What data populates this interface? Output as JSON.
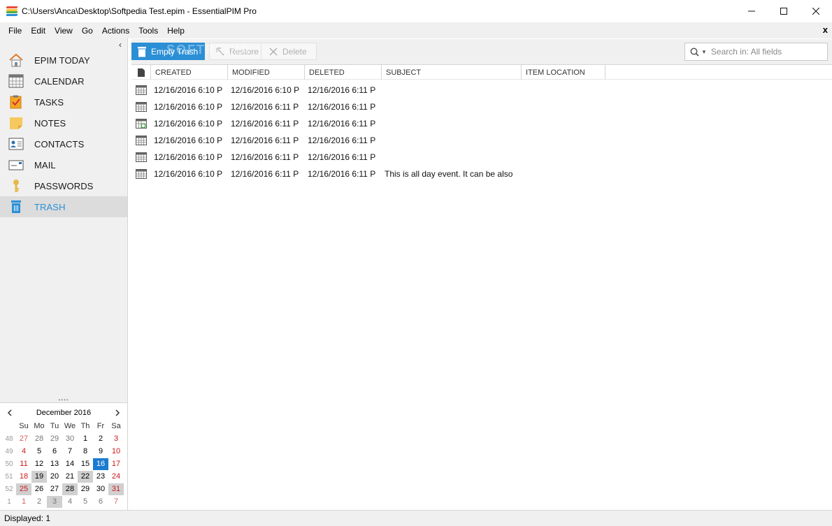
{
  "window": {
    "title": "C:\\Users\\Anca\\Desktop\\Softpedia Test.epim - EssentialPIM Pro",
    "minimize": "—",
    "maximize": "☐",
    "close": "✕"
  },
  "menu": {
    "items": [
      "File",
      "Edit",
      "View",
      "Go",
      "Actions",
      "Tools",
      "Help"
    ],
    "close": "x"
  },
  "sidebar": {
    "collapse": "‹",
    "items": [
      {
        "label": "EPIM TODAY",
        "icon": "house-icon"
      },
      {
        "label": "CALENDAR",
        "icon": "calendar-icon"
      },
      {
        "label": "TASKS",
        "icon": "clipboard-check-icon"
      },
      {
        "label": "NOTES",
        "icon": "sticky-note-icon"
      },
      {
        "label": "CONTACTS",
        "icon": "contact-card-icon"
      },
      {
        "label": "MAIL",
        "icon": "envelope-icon"
      },
      {
        "label": "PASSWORDS",
        "icon": "key-icon"
      },
      {
        "label": "TRASH",
        "icon": "trash-icon",
        "active": true
      }
    ]
  },
  "calendar": {
    "prev": "‹",
    "next": "›",
    "title": "December  2016",
    "days": [
      "Su",
      "Mo",
      "Tu",
      "We",
      "Th",
      "Fr",
      "Sa"
    ],
    "weeks": [
      {
        "wk": "48",
        "dates": [
          "27",
          "28",
          "29",
          "30",
          "1",
          "2",
          "3"
        ]
      },
      {
        "wk": "49",
        "dates": [
          "4",
          "5",
          "6",
          "7",
          "8",
          "9",
          "10"
        ]
      },
      {
        "wk": "50",
        "dates": [
          "11",
          "12",
          "13",
          "14",
          "15",
          "16",
          "17"
        ]
      },
      {
        "wk": "51",
        "dates": [
          "18",
          "19",
          "20",
          "21",
          "22",
          "23",
          "24"
        ]
      },
      {
        "wk": "52",
        "dates": [
          "25",
          "26",
          "27",
          "28",
          "29",
          "30",
          "31"
        ]
      },
      {
        "wk": "1",
        "dates": [
          "1",
          "2",
          "3",
          "4",
          "5",
          "6",
          "7"
        ]
      }
    ]
  },
  "toolbar": {
    "empty_trash": "Empty Trash",
    "restore": "Restore",
    "delete": "Delete",
    "watermark": "SOFTPEDIA",
    "search_placeholder": "Search in: All fields"
  },
  "table": {
    "columns": [
      "CREATED",
      "MODIFIED",
      "DELETED",
      "SUBJECT",
      "ITEM LOCATION"
    ],
    "rows": [
      {
        "created": "12/16/2016 6:10 P",
        "modified": "12/16/2016 6:10 P",
        "deleted": "12/16/2016 6:11 P",
        "subject": "",
        "location": ""
      },
      {
        "created": "12/16/2016 6:10 P",
        "modified": "12/16/2016 6:11 P",
        "deleted": "12/16/2016 6:11 P",
        "subject": "",
        "location": ""
      },
      {
        "created": "12/16/2016 6:10 P",
        "modified": "12/16/2016 6:11 P",
        "deleted": "12/16/2016 6:11 P",
        "subject": "",
        "location": ""
      },
      {
        "created": "12/16/2016 6:10 P",
        "modified": "12/16/2016 6:11 P",
        "deleted": "12/16/2016 6:11 P",
        "subject": "",
        "location": ""
      },
      {
        "created": "12/16/2016 6:10 P",
        "modified": "12/16/2016 6:11 P",
        "deleted": "12/16/2016 6:11 P",
        "subject": "",
        "location": ""
      },
      {
        "created": "12/16/2016 6:10 P",
        "modified": "12/16/2016 6:11 P",
        "deleted": "12/16/2016 6:11 P",
        "subject": "This is all day event. It can be also",
        "location": ""
      }
    ]
  },
  "status": {
    "text": "Displayed: 1"
  },
  "colors": {
    "accent": "#2b8fd6",
    "today": "#1a7bd0",
    "weekend": "#d01818"
  }
}
